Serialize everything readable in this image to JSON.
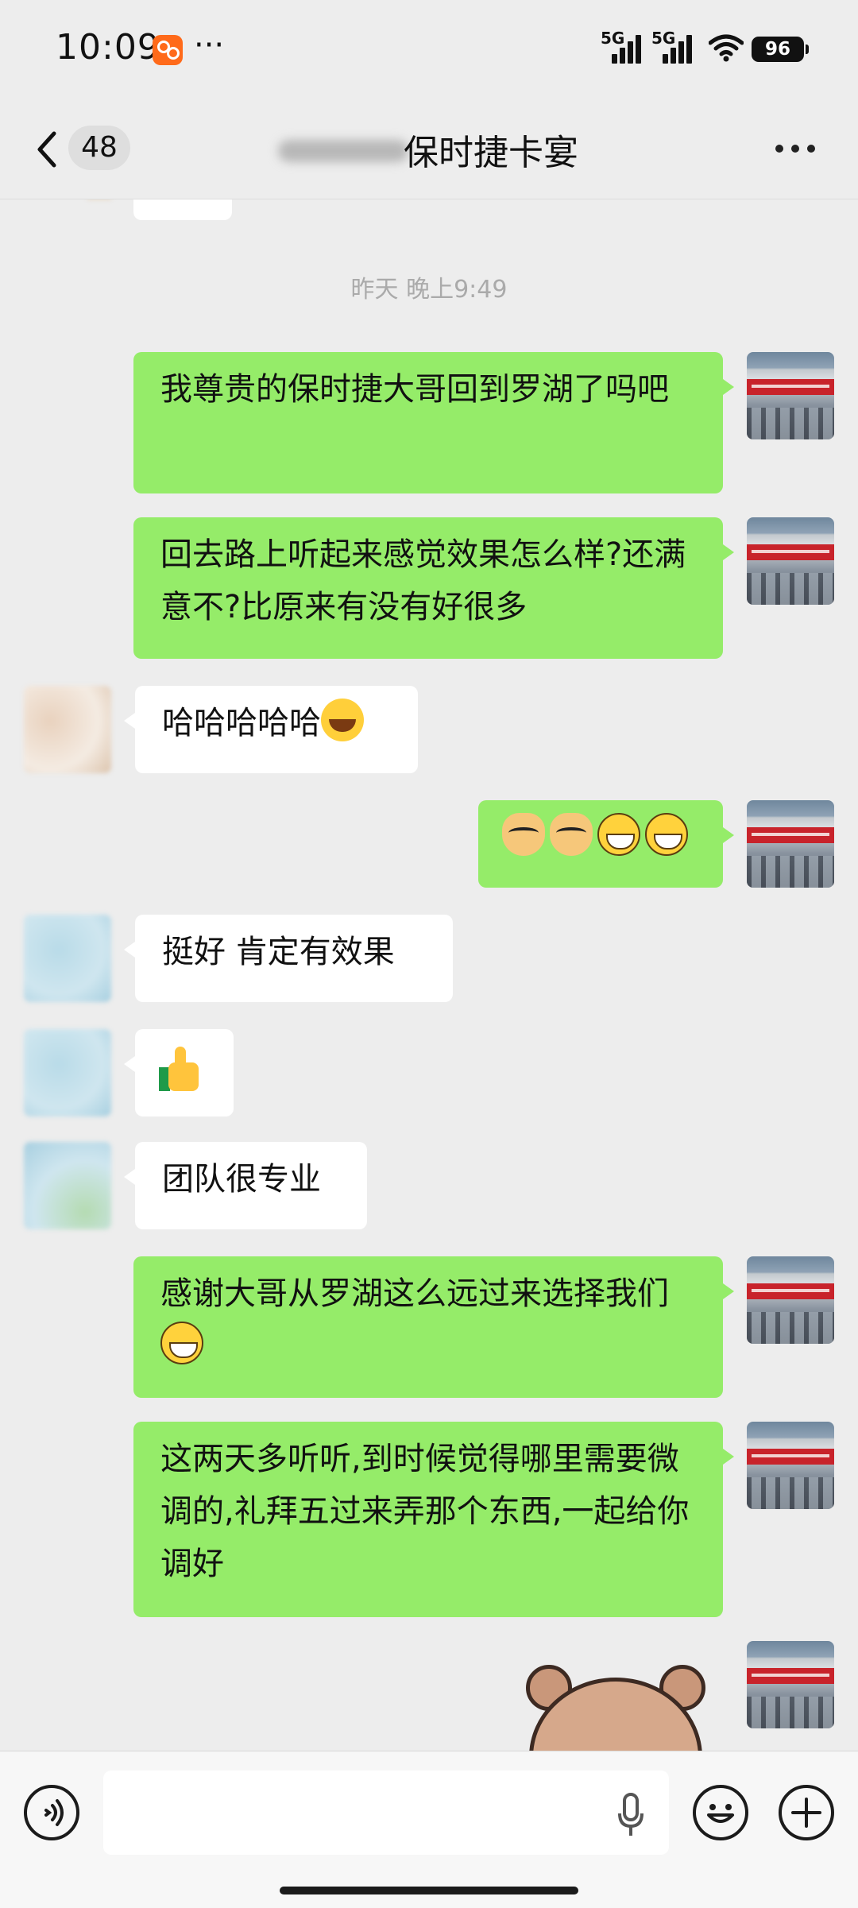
{
  "status_bar": {
    "time": "10:09",
    "more_dots": "···",
    "signal_1_label": "5G",
    "signal_2_label": "5G",
    "battery": "96"
  },
  "nav": {
    "unread_count": "48",
    "title": "保时捷卡宴"
  },
  "chat": {
    "timestamp": "昨天 晚上9:49",
    "messages": [
      {
        "side": "right",
        "text": "我尊贵的保时捷大哥回到罗湖了吗吧"
      },
      {
        "side": "right",
        "text": "回去路上听起来感觉效果怎么样?还满意不?比原来有没有好很多"
      },
      {
        "side": "left",
        "text": "哈哈哈哈哈",
        "emoji": "laughing-crying-emoji"
      },
      {
        "side": "right",
        "emoji_sequence": [
          "doge-emoji",
          "doge-emoji",
          "grin-emoji",
          "grin-emoji"
        ]
      },
      {
        "side": "left",
        "text": "挺好 肯定有效果"
      },
      {
        "side": "left",
        "emoji": "thumbs-up-emoji"
      },
      {
        "side": "left",
        "text": "团队很专业"
      },
      {
        "side": "right",
        "text": "感谢大哥从罗湖这么远过来选择我们",
        "emoji": "grin-emoji"
      },
      {
        "side": "right",
        "text": "这两天多听听,到时候觉得哪里需要微调的,礼拜五过来弄那个东西,一起给你调好"
      },
      {
        "side": "right",
        "sticker": "bear-sticker"
      }
    ]
  },
  "input_bar": {
    "voice_icon": "voice-mode-icon",
    "mic_icon": "microphone-icon",
    "emoji_icon": "emoji-icon",
    "plus_icon": "plus-icon"
  },
  "colors": {
    "background": "#ededed",
    "self_bubble": "#95ec69",
    "other_bubble": "#ffffff"
  }
}
